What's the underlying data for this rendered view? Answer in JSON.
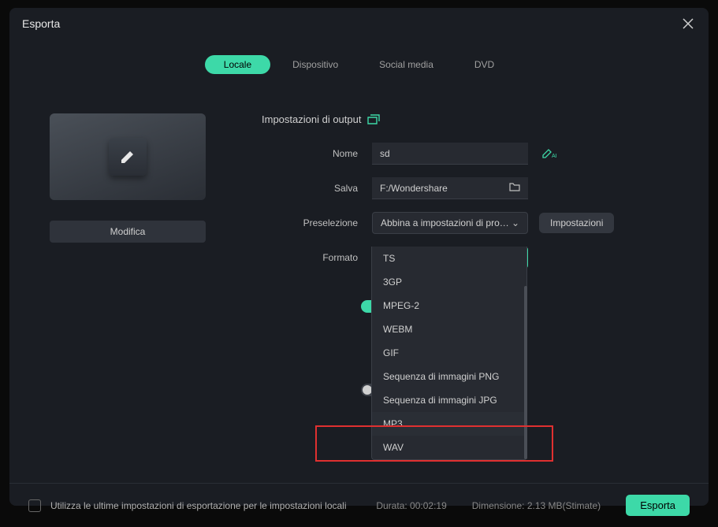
{
  "modal": {
    "title": "Esporta"
  },
  "tabs": {
    "items": [
      {
        "label": "Locale",
        "active": true
      },
      {
        "label": "Dispositivo",
        "active": false
      },
      {
        "label": "Social media",
        "active": false
      },
      {
        "label": "DVD",
        "active": false
      }
    ]
  },
  "preview": {
    "edit_label": "Modifica"
  },
  "section": {
    "title": "Impostazioni di output"
  },
  "fields": {
    "name": {
      "label": "Nome",
      "value": "sd"
    },
    "save": {
      "label": "Salva",
      "value": "F:/Wondershare"
    },
    "preset": {
      "label": "Preselezione",
      "value": "Abbina a impostazioni di progetto",
      "settings_btn": "Impostazioni"
    },
    "format": {
      "label": "Formato",
      "value": "MP3"
    }
  },
  "format_options": [
    {
      "label": "TS"
    },
    {
      "label": "3GP"
    },
    {
      "label": "MPEG-2"
    },
    {
      "label": "WEBM"
    },
    {
      "label": "GIF"
    },
    {
      "label": "Sequenza di immagini PNG"
    },
    {
      "label": "Sequenza di immagini JPG"
    },
    {
      "label": "MP3"
    },
    {
      "label": "WAV"
    }
  ],
  "footer": {
    "checkbox_label": "Utilizza le ultime impostazioni di esportazione per le impostazioni locali",
    "duration_label": "Durata:",
    "duration_value": "00:02:19",
    "size_label": "Dimensione:",
    "size_value": "2.13 MB(Stimate)",
    "export_btn": "Esporta"
  }
}
